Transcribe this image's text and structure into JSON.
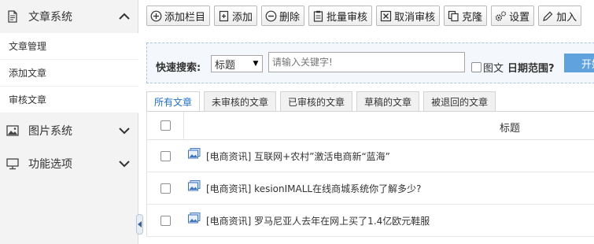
{
  "sidebar": {
    "sections": [
      {
        "label": "文章系统",
        "icon": "document-icon",
        "expanded": true
      },
      {
        "label": "图片系统",
        "icon": "image-icon",
        "expanded": false
      },
      {
        "label": "功能选项",
        "icon": "monitor-icon",
        "expanded": false
      }
    ],
    "sub_items": [
      "文章管理",
      "添加文章",
      "审核文章"
    ]
  },
  "toolbar": {
    "buttons": [
      {
        "label": "添加栏目",
        "icon": "plus-circle-icon"
      },
      {
        "label": "添加",
        "icon": "add-document-icon"
      },
      {
        "label": "删除",
        "icon": "minus-circle-icon"
      },
      {
        "label": "批量审核",
        "icon": "clipboard-icon"
      },
      {
        "label": "取消审核",
        "icon": "cross-box-icon"
      },
      {
        "label": "克隆",
        "icon": "copy-icon"
      },
      {
        "label": "设置",
        "icon": "gears-icon"
      },
      {
        "label": "加入",
        "icon": "pencil-icon"
      }
    ]
  },
  "search": {
    "label": "快速搜索:",
    "field_selected": "标题",
    "placeholder": "请输入关键字!",
    "image_checkbox_label": "图文",
    "date_range_label": "日期范围?",
    "start_button": "开始"
  },
  "tabs": [
    "所有文章",
    "未审核的文章",
    "已审核的文章",
    "草稿的文章",
    "被退回的文章"
  ],
  "table": {
    "header_title": "标题",
    "rows": [
      {
        "title": "[电商资讯] 互联网+农村”激活电商新“蓝海”"
      },
      {
        "title": "[电商资讯] kesionIMALL在线商城系统你了解多少?"
      },
      {
        "title": "[电商资讯] 罗马尼亚人去年在网上买了1.4亿欧元鞋服"
      }
    ]
  },
  "colors": {
    "accent": "#1f6fc5",
    "start_button": "#5fa2dd",
    "search_border": "#a9c3e0"
  }
}
